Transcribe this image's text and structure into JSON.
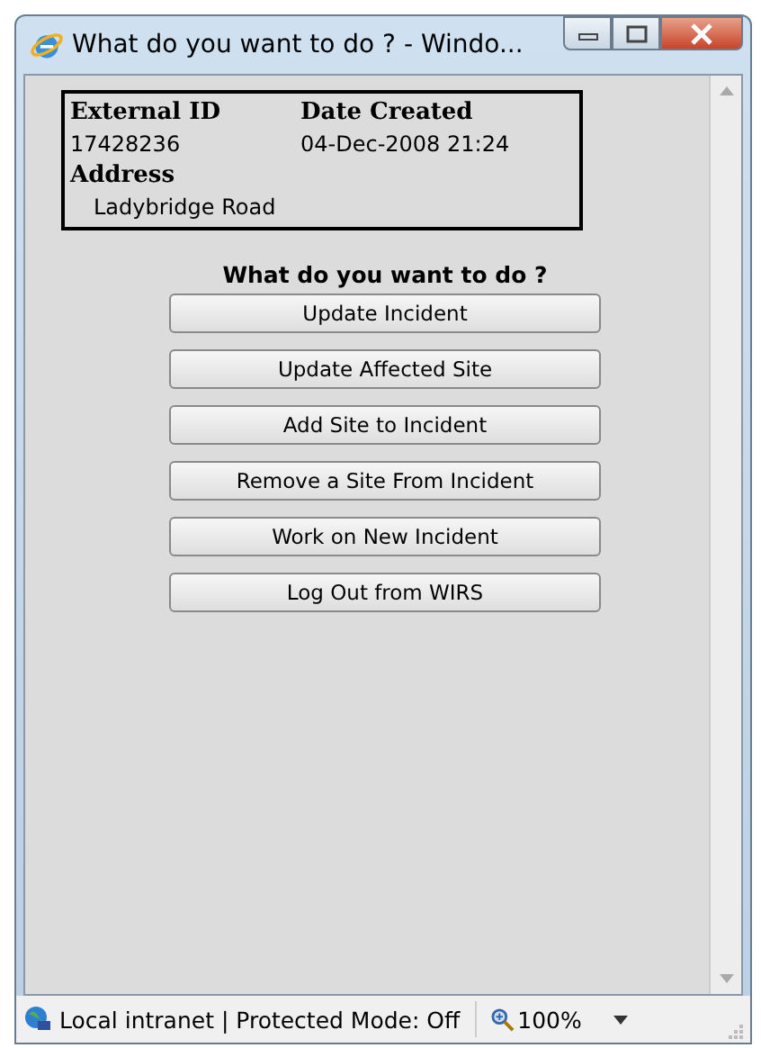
{
  "window": {
    "title": "What do you want to do ? - Windo..."
  },
  "info": {
    "external_id_label": "External ID",
    "date_created_label": "Date Created",
    "external_id": "17428236",
    "date_created": "04-Dec-2008 21:24",
    "address_label": "Address",
    "address": "Ladybridge Road"
  },
  "prompt": "What do you want to do ?",
  "buttons": [
    "Update Incident",
    "Update Affected Site",
    "Add Site to Incident",
    "Remove a Site From Incident",
    "Work on New Incident",
    "Log Out from WIRS"
  ],
  "status_bar": {
    "zone": "Local intranet | Protected Mode: Off",
    "zoom": "100%"
  }
}
